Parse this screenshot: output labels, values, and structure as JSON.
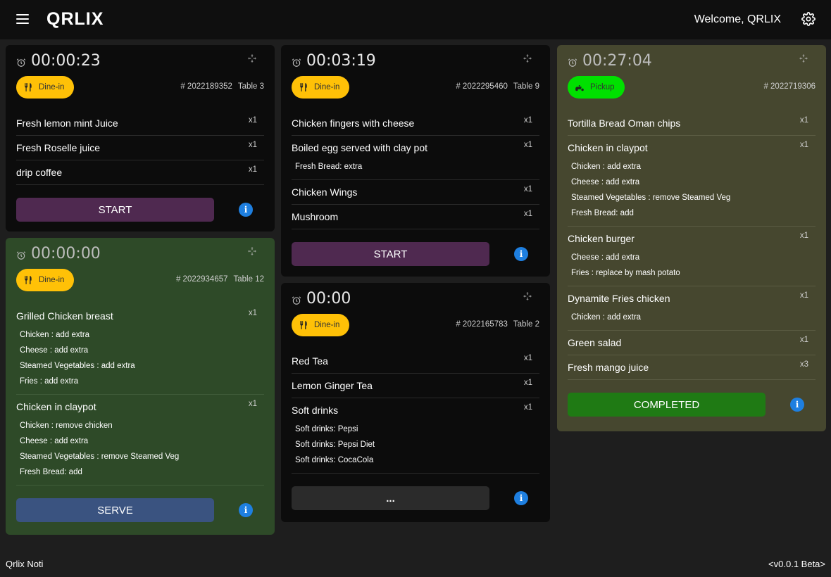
{
  "header": {
    "logo": "QRLIX",
    "welcome": "Welcome, QRLIX"
  },
  "orders": [
    {
      "timer": "00:00:23",
      "type": "Dine-in",
      "order_no": "# 2022189352",
      "table": "Table 3",
      "items": [
        {
          "name": "Fresh lemon mint Juice",
          "qty": "x1",
          "mods": []
        },
        {
          "name": "Fresh Roselle juice",
          "qty": "x1",
          "mods": []
        },
        {
          "name": "drip coffee",
          "qty": "x1",
          "mods": []
        }
      ],
      "action": "START"
    },
    {
      "timer": "00:00:00",
      "type": "Dine-in",
      "order_no": "# 2022934657",
      "table": "Table 12",
      "items": [
        {
          "name": "Grilled Chicken breast",
          "qty": "x1",
          "mods": [
            "Chicken : add extra",
            "Cheese : add extra",
            "Steamed Vegetables : add extra",
            "Fries : add extra"
          ]
        },
        {
          "name": "Chicken in claypot",
          "qty": "x1",
          "mods": [
            "Chicken : remove chicken",
            "Cheese : add extra",
            "Steamed Vegetables : remove Steamed Veg",
            "Fresh Bread: add"
          ]
        }
      ],
      "action": "SERVE"
    },
    {
      "timer": "00:03:19",
      "type": "Dine-in",
      "order_no": "# 2022295460",
      "table": "Table 9",
      "items": [
        {
          "name": "Chicken fingers with cheese",
          "qty": "x1",
          "mods": []
        },
        {
          "name": "Boiled egg served with clay pot",
          "qty": "x1",
          "mods": [
            "Fresh Bread: extra"
          ]
        },
        {
          "name": "Chicken Wings",
          "qty": "x1",
          "mods": []
        },
        {
          "name": "Mushroom",
          "qty": "x1",
          "mods": []
        }
      ],
      "action": "START"
    },
    {
      "timer": "00:00",
      "type": "Dine-in",
      "order_no": "# 2022165783",
      "table": "Table 2",
      "items": [
        {
          "name": "Red Tea",
          "qty": "x1",
          "mods": []
        },
        {
          "name": "Lemon Ginger Tea",
          "qty": "x1",
          "mods": []
        },
        {
          "name": "Soft drinks",
          "qty": "x1",
          "mods": [
            "Soft drinks: Pepsi",
            "Soft drinks: Pepsi Diet",
            "Soft drinks: CocaCola"
          ]
        }
      ],
      "action": "..."
    },
    {
      "timer": "00:27:04",
      "type": "Pickup",
      "order_no": "# 2022719306",
      "table": "",
      "items": [
        {
          "name": "Tortilla Bread Oman chips",
          "qty": "x1",
          "mods": []
        },
        {
          "name": "Chicken in claypot",
          "qty": "x1",
          "mods": [
            "Chicken : add extra",
            "Cheese : add extra",
            "Steamed Vegetables : remove Steamed Veg",
            "Fresh Bread: add"
          ]
        },
        {
          "name": "Chicken burger",
          "qty": "x1",
          "mods": [
            "Cheese : add extra",
            "Fries : replace by mash potato"
          ]
        },
        {
          "name": "Dynamite Fries chicken",
          "qty": "x1",
          "mods": [
            "Chicken : add extra"
          ]
        },
        {
          "name": "Green salad",
          "qty": "x1",
          "mods": []
        },
        {
          "name": "Fresh mango juice",
          "qty": "x3",
          "mods": []
        }
      ],
      "action": "COMPLETED"
    }
  ],
  "footer": {
    "left": "Qrlix Noti",
    "right": "<v0.0.1 Beta>"
  },
  "colors": {
    "background": "#1e1e1e",
    "topbar": "#0f0f0f",
    "card_black": "#0c0c0c",
    "card_green": "#2e4a28",
    "card_olive": "#46472f",
    "badge_dinein": "#ffc107",
    "badge_pickup": "#00e000",
    "btn_start": "#4f2950",
    "btn_serve": "#3a5380",
    "btn_completed": "#1f7a14",
    "info": "#1e7fe0"
  },
  "icons": {
    "menu": "hamburger-icon",
    "settings": "gear-icon",
    "timer": "alarm-clock-icon",
    "drag": "move-icon",
    "dinein": "fork-knife-icon",
    "pickup": "scooter-icon",
    "info": "info-icon"
  }
}
